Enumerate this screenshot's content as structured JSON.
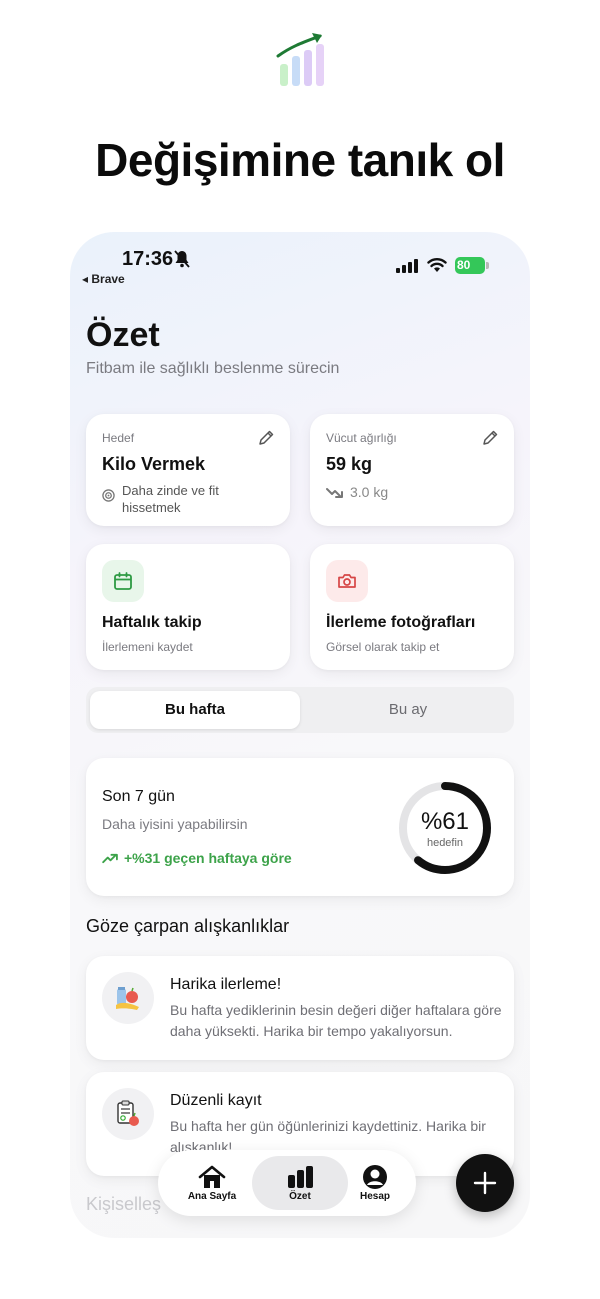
{
  "header": {
    "headline": "Değişimine tanık ol"
  },
  "status_bar": {
    "time": "17:36",
    "back_app": "◂ Brave",
    "battery": "80"
  },
  "page": {
    "title": "Özet",
    "subtitle": "Fitbam ile sağlıklı beslenme sürecin"
  },
  "goal_card": {
    "label": "Hedef",
    "value": "Kilo Vermek",
    "note": "Daha zinde ve fit hissetmek"
  },
  "weight_card": {
    "label": "Vücut ağırlığı",
    "value": "59 kg",
    "change": "3.0 kg"
  },
  "weekly_card": {
    "title": "Haftalık takip",
    "subtitle": "İlerlemeni kaydet"
  },
  "photos_card": {
    "title": "İlerleme fotoğrafları",
    "subtitle": "Görsel olarak takip et"
  },
  "segment": {
    "active": "Bu hafta",
    "inactive": "Bu ay"
  },
  "summary_card": {
    "title": "Son 7 gün",
    "subtitle": "Daha iyisini yapabilirsin",
    "trend": "+%31 geçen haftaya göre",
    "progress_label": "%61",
    "progress_value": 0.61,
    "progress_caption": "hedefin"
  },
  "habits": {
    "section_title": "Göze çarpan alışkanlıklar",
    "items": [
      {
        "title": "Harika ilerleme!",
        "desc": "Bu hafta yediklerinin besin değeri diğer haftalara göre daha yüksekti. Harika bir tempo yakalıyorsun."
      },
      {
        "title": "Düzenli kayıt",
        "desc": "Bu hafta her gün öğünlerinizi kaydettiniz. Harika bir alışkanlık!"
      }
    ],
    "next_section_partial": "Kişiselleş"
  },
  "tabbar": {
    "home": "Ana Sayfa",
    "summary": "Özet",
    "account": "Hesap"
  },
  "colors": {
    "accent_green": "#3da34a",
    "ring": "#111111",
    "battery": "#34c759",
    "photo_icon": "#d64545"
  }
}
